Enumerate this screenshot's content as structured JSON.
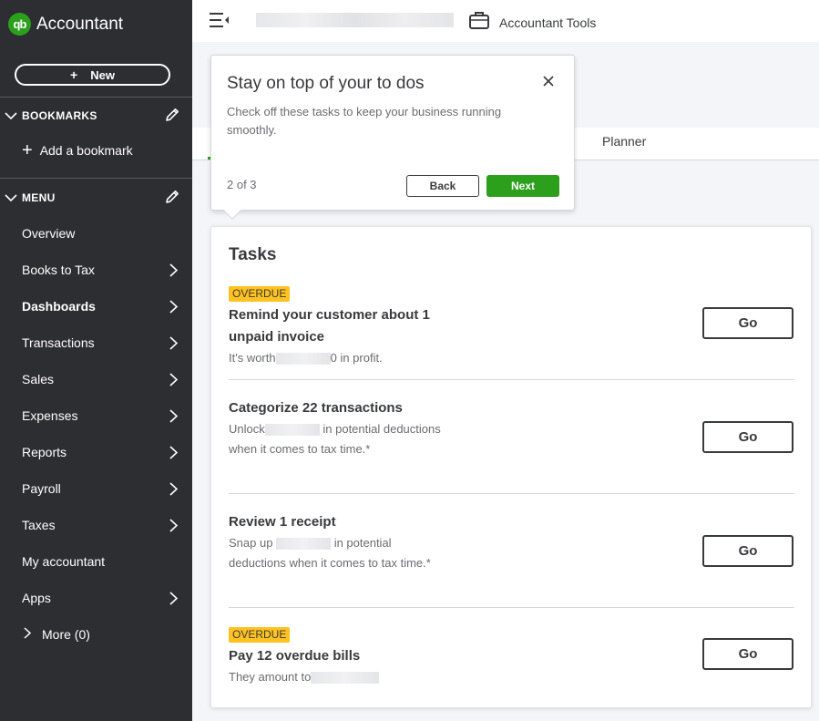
{
  "brand": {
    "logo_text": "qb",
    "name": "Accountant"
  },
  "sidebar": {
    "new_label": "New",
    "bookmarks_label": "BOOKMARKS",
    "add_bookmark_label": "Add a bookmark",
    "menu_label": "MENU",
    "items": [
      {
        "label": "Overview",
        "arrow": false,
        "bold": false
      },
      {
        "label": "Books to Tax",
        "arrow": true,
        "bold": false
      },
      {
        "label": "Dashboards",
        "arrow": true,
        "bold": true
      },
      {
        "label": "Transactions",
        "arrow": true,
        "bold": false
      },
      {
        "label": "Sales",
        "arrow": true,
        "bold": false
      },
      {
        "label": "Expenses",
        "arrow": true,
        "bold": false
      },
      {
        "label": "Reports",
        "arrow": true,
        "bold": false
      },
      {
        "label": "Payroll",
        "arrow": true,
        "bold": false
      },
      {
        "label": "Taxes",
        "arrow": true,
        "bold": false
      },
      {
        "label": "My accountant",
        "arrow": false,
        "bold": false
      },
      {
        "label": "Apps",
        "arrow": true,
        "bold": false
      }
    ],
    "more_label": "More (0)"
  },
  "topbar": {
    "tools_label": "Accountant Tools"
  },
  "tabs": {
    "planner_label": "Planner"
  },
  "popover": {
    "title": "Stay on top of your to dos",
    "body": "Check off these tasks to keep your business running smoothly.",
    "step": "2 of 3",
    "back_label": "Back",
    "next_label": "Next"
  },
  "tasks": {
    "title": "Tasks",
    "items": [
      {
        "badge": "OVERDUE",
        "title": "Remind your customer about 1 unpaid invoice",
        "sub_before": "It's worth",
        "sub_after": "0 in profit.",
        "go": "Go"
      },
      {
        "badge": "",
        "title": "Categorize 22 transactions",
        "sub_before": "Unlock",
        "sub_after": "in potential deductions when it comes to tax time.*",
        "go": "Go"
      },
      {
        "badge": "",
        "title": "Review 1 receipt",
        "sub_before": "Snap up",
        "sub_after": "in potential deductions when it comes to tax time.*",
        "go": "Go"
      },
      {
        "badge": "OVERDUE",
        "title": "Pay 12 overdue bills",
        "sub_before": "They amount to",
        "sub_after": "",
        "go": "Go"
      }
    ]
  },
  "colors": {
    "sidebar_bg": "#2d2e31",
    "accent_green": "#2ca01c",
    "badge_yellow": "#ffc220"
  }
}
